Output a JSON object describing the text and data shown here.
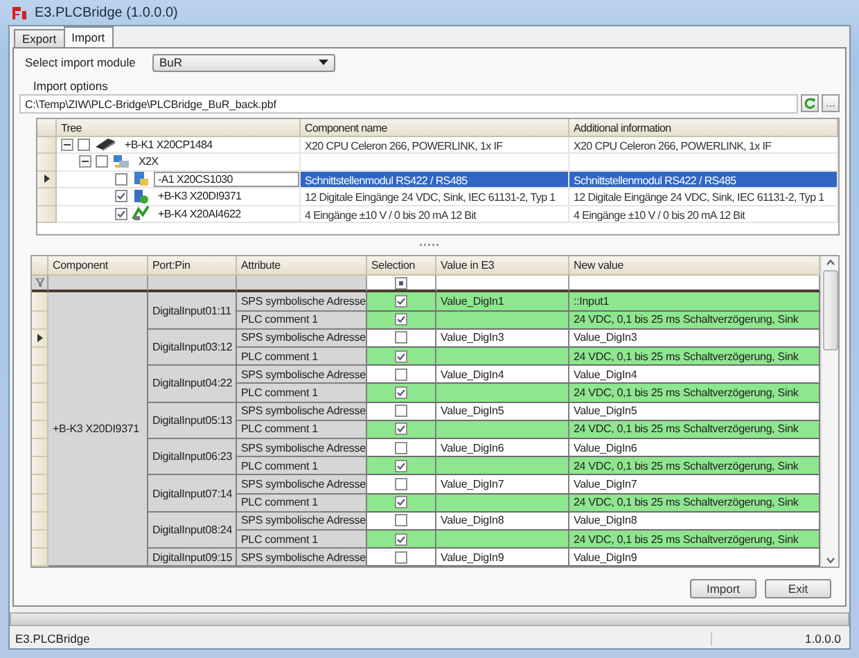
{
  "window": {
    "title": "E3.PLCBridge (1.0.0.0)"
  },
  "tabs": [
    {
      "label": "Export",
      "selected": false
    },
    {
      "label": "Import",
      "selected": true
    }
  ],
  "import_module": {
    "label": "Select import module",
    "value": "BuR"
  },
  "import_options": {
    "label": "Import options",
    "path": "C:\\Temp\\ZIW\\PLC-Bridge\\PLCBridge_BuR_back.pbf",
    "browse_label": "..."
  },
  "tree_grid": {
    "columns": [
      "Tree",
      "Component name",
      "Additional information"
    ],
    "items": [
      {
        "kind": "cpu",
        "label": "+B-K1 X20CP1484",
        "component_name": "X20 CPU Celeron 266, POWERLINK, 1x IF",
        "additional_information": "X20 CPU Celeron 266, POWERLINK, 1x IF",
        "checked": false,
        "expanded": true,
        "selected": false,
        "children": [
          {
            "kind": "bus",
            "label": "X2X",
            "checked": false,
            "expanded": true,
            "selected": false,
            "children": [
              {
                "kind": "interface",
                "label": "-A1 X20CS1030",
                "component_name": "Schnittstellenmodul RS422 / RS485",
                "additional_information": "Schnittstellenmodul RS422 / RS485",
                "checked": false,
                "selected": true
              },
              {
                "kind": "digital",
                "label": "+B-K3 X20DI9371",
                "component_name": "12 Digitale Eingänge 24 VDC, Sink, IEC 61131-2, Typ 1",
                "additional_information": "12 Digitale Eingänge 24 VDC, Sink, IEC 61131-2, Typ 1",
                "checked": true,
                "selected": false
              },
              {
                "kind": "analog",
                "label": "+B-K4 X20AI4622",
                "component_name": "4 Eingänge ±10 V / 0 bis 20 mA  12 Bit",
                "additional_information": "4 Eingänge ±10 V / 0 bis 20 mA  12 Bit",
                "checked": true,
                "selected": false
              }
            ]
          }
        ]
      }
    ]
  },
  "mapping_grid": {
    "columns": [
      "Component",
      "Port:Pin",
      "Attribute",
      "Selection",
      "Value in E3",
      "New value"
    ],
    "filter_selection_partial": true,
    "component": "+B-K3 X20DI9371",
    "pins": [
      {
        "name": "DigitalInput01:11",
        "attributes": [
          {
            "name": "SPS symbolische Adresse",
            "checked": true,
            "current": false,
            "value_in_e3": "Value_DigIn1",
            "new_value": "::Input1"
          },
          {
            "name": "PLC comment 1",
            "checked": true,
            "current": false,
            "new_value": "24 VDC, 0,1 bis 25 ms Schaltverzögerung, Sink"
          }
        ]
      },
      {
        "name": "DigitalInput03:12",
        "attributes": [
          {
            "name": "SPS symbolische Adresse",
            "checked": false,
            "current": true,
            "value_in_e3": "Value_DigIn3",
            "new_value": "Value_DigIn3"
          },
          {
            "name": "PLC comment 1",
            "checked": true,
            "current": false,
            "new_value": "24 VDC, 0,1 bis 25 ms Schaltverzögerung, Sink"
          }
        ]
      },
      {
        "name": "DigitalInput04:22",
        "attributes": [
          {
            "name": "SPS symbolische Adresse",
            "checked": false,
            "current": false,
            "value_in_e3": "Value_DigIn4",
            "new_value": "Value_DigIn4"
          },
          {
            "name": "PLC comment 1",
            "checked": true,
            "current": false,
            "new_value": "24 VDC, 0,1 bis 25 ms Schaltverzögerung, Sink"
          }
        ]
      },
      {
        "name": "DigitalInput05:13",
        "attributes": [
          {
            "name": "SPS symbolische Adresse",
            "checked": false,
            "current": false,
            "value_in_e3": "Value_DigIn5",
            "new_value": "Value_DigIn5"
          },
          {
            "name": "PLC comment 1",
            "checked": true,
            "current": false,
            "new_value": "24 VDC, 0,1 bis 25 ms Schaltverzögerung, Sink"
          }
        ]
      },
      {
        "name": "DigitalInput06:23",
        "attributes": [
          {
            "name": "SPS symbolische Adresse",
            "checked": false,
            "current": false,
            "value_in_e3": "Value_DigIn6",
            "new_value": "Value_DigIn6"
          },
          {
            "name": "PLC comment 1",
            "checked": true,
            "current": false,
            "new_value": "24 VDC, 0,1 bis 25 ms Schaltverzögerung, Sink"
          }
        ]
      },
      {
        "name": "DigitalInput07:14",
        "attributes": [
          {
            "name": "SPS symbolische Adresse",
            "checked": false,
            "current": false,
            "value_in_e3": "Value_DigIn7",
            "new_value": "Value_DigIn7"
          },
          {
            "name": "PLC comment 1",
            "checked": true,
            "current": false,
            "new_value": "24 VDC, 0,1 bis 25 ms Schaltverzögerung, Sink"
          }
        ]
      },
      {
        "name": "DigitalInput08:24",
        "attributes": [
          {
            "name": "SPS symbolische Adresse",
            "checked": false,
            "current": false,
            "value_in_e3": "Value_DigIn8",
            "new_value": "Value_DigIn8"
          },
          {
            "name": "PLC comment 1",
            "checked": true,
            "current": false,
            "new_value": "24 VDC, 0,1 bis 25 ms Schaltverzögerung, Sink"
          }
        ]
      },
      {
        "name": "DigitalInput09:15",
        "attributes": [
          {
            "name": "SPS symbolische Adresse",
            "checked": false,
            "current": false,
            "value_in_e3": "Value_DigIn9",
            "new_value": "Value_DigIn9"
          }
        ]
      }
    ]
  },
  "buttons": [
    "Import",
    "Exit"
  ],
  "progress": {
    "level": 0
  },
  "status_bar": {
    "text": "E3.PLCBridge",
    "version": "1.0.0.0"
  }
}
